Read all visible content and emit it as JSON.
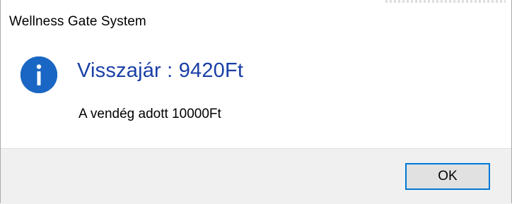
{
  "window": {
    "title": "Wellness Gate System"
  },
  "message": {
    "main_instruction": "Visszajár : 9420Ft",
    "content": "A vendég adott 10000Ft",
    "icon": "info-icon"
  },
  "buttons": {
    "ok_label": "OK"
  },
  "colors": {
    "accent": "#0078d7",
    "icon_blue": "#1565c0",
    "instruction_blue": "#1a3fa6",
    "footer_bg": "#f0f0f0"
  }
}
